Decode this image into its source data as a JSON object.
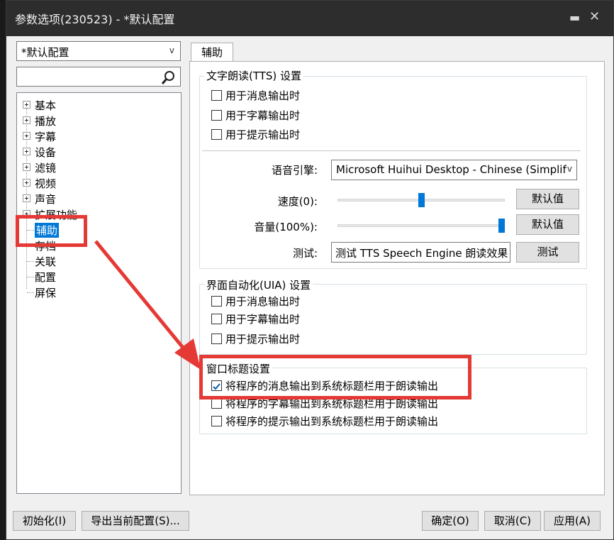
{
  "window": {
    "title": "参数选项(230523) - *默认配置",
    "pin_icon": "pin-icon",
    "close_icon": "close-icon"
  },
  "profile": {
    "selected": "*默认配置",
    "arrow": "v"
  },
  "tree": {
    "items": [
      "基本",
      "播放",
      "字幕",
      "设备",
      "滤镜",
      "视频",
      "声音",
      "扩展功能",
      "辅助",
      "存档",
      "关联",
      "配置",
      "屏保"
    ]
  },
  "tab": {
    "label": "辅助"
  },
  "tts": {
    "title": "文字朗读(TTS) 设置",
    "opts": [
      "用于消息输出时",
      "用于字幕输出时",
      "用于提示输出时"
    ],
    "engine_label": "语音引擎:",
    "engine_value": "Microsoft Huihui Desktop - Chinese (Simplified)",
    "engine_arrow": "v",
    "speed_label": "速度(0):",
    "speed_value": 0.5,
    "volume_label": "音量(100%):",
    "volume_value": 1.0,
    "default_btn": "默认值",
    "test_label": "测试:",
    "test_text": "测试 TTS Speech Engine 朗读效果",
    "test_btn": "测试"
  },
  "uia": {
    "title": "界面自动化(UIA) 设置",
    "opts": [
      "用于消息输出时",
      "用于字幕输出时",
      "用于提示输出时"
    ]
  },
  "wintitle": {
    "title": "窗口标题设置",
    "opts": [
      "将程序的消息输出到系统标题栏用于朗读输出",
      "将程序的字幕输出到系统标题栏用于朗读输出",
      "将程序的提示输出到系统标题栏用于朗读输出"
    ],
    "checked": [
      true,
      false,
      false
    ]
  },
  "footer": {
    "init": "初始化(I)",
    "export": "导出当前配置(S)...",
    "ok": "确定(O)",
    "cancel": "取消(C)",
    "apply": "应用(A)"
  },
  "annotation_color": "#e53935"
}
